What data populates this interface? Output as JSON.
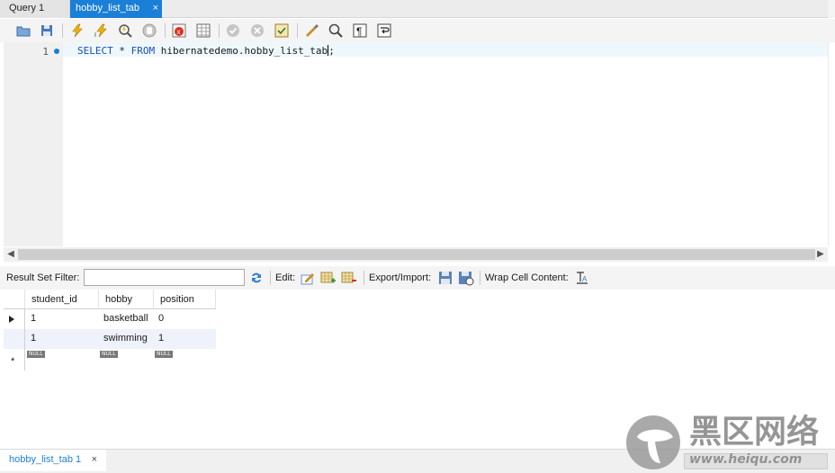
{
  "tabs": [
    {
      "label": "Query 1"
    },
    {
      "label": "hobby_list_tab",
      "close": "×"
    }
  ],
  "toolbar": {
    "icons": [
      "open-folder-icon",
      "save-icon",
      "execute-icon",
      "execute-current-icon",
      "explain-icon",
      "stop-icon",
      "toggle-error-icon",
      "toggle-result-icon",
      "commit-icon",
      "rollback-icon",
      "autocommit-icon",
      "beautify-icon",
      "find-icon",
      "invisible-chars-icon",
      "word-wrap-icon"
    ]
  },
  "editor": {
    "line_number": "1",
    "sql_keyword_1": "SELECT",
    "sql_star": " * ",
    "sql_keyword_2": "FROM",
    "sql_rest": " hibernatedemo.hobby_list_tab",
    "sql_semicolon": ";"
  },
  "results_toolbar": {
    "filter_label": "Result Set Filter:",
    "filter_value": "",
    "edit_label": "Edit:",
    "export_label": "Export/Import:",
    "wrap_label": "Wrap Cell Content:"
  },
  "grid": {
    "columns": [
      "student_id",
      "hobby",
      "position"
    ],
    "rows": [
      [
        "1",
        "basketball",
        "0"
      ],
      [
        "1",
        "swimming",
        "1"
      ]
    ],
    "new_row_marker": "*",
    "null_label": "NULL"
  },
  "bottom_tab": {
    "label": "hobby_list_tab 1",
    "close": "×"
  },
  "watermark": {
    "brand": "黑区网络",
    "url": "www.heiqu.com"
  },
  "colors": {
    "accent": "#1a7fd6",
    "keyword": "#1a4fb5",
    "alt_row": "#eef2fb",
    "watermark_red": "#c0392b"
  }
}
